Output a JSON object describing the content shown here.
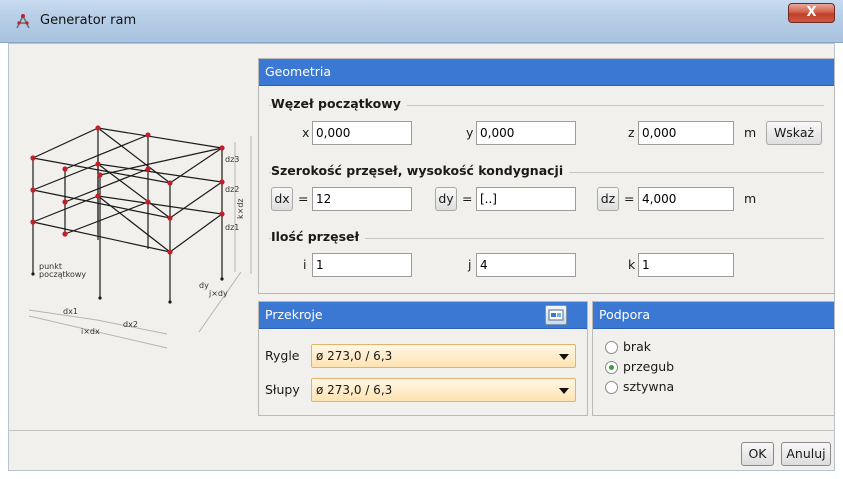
{
  "window": {
    "title": "Generator ram",
    "close_label": "X"
  },
  "diagram": {
    "labels": {
      "dz3": "dz3",
      "dz2": "dz2",
      "dz1": "dz1",
      "kdz": "k×dz",
      "dy": "dy",
      "jdy": "j×dy",
      "dx1": "dx1",
      "dx2": "dx2",
      "idx": "i×dx",
      "punkt": "punkt",
      "poczatkowy": "początkowy"
    }
  },
  "geometria": {
    "title": "Geometria",
    "wezel": {
      "title": "Węzeł początkowy",
      "x_label": "x",
      "x_value": "0,000",
      "y_label": "y",
      "y_value": "0,000",
      "z_label": "z",
      "z_value": "0,000",
      "unit": "m",
      "wskaz_label": "Wskaż"
    },
    "szerokosc": {
      "title": "Szerokość przęseł, wysokość kondygnacji",
      "dx_label": "dx",
      "dx_value": "12",
      "dy_label": "dy",
      "dy_value": "[..]",
      "dz_label": "dz",
      "dz_value": "4,000",
      "eq": "=",
      "unit": "m"
    },
    "ilosc": {
      "title": "Ilość przęseł",
      "i_label": "i",
      "i_value": "1",
      "j_label": "j",
      "j_value": "4",
      "k_label": "k",
      "k_value": "1"
    }
  },
  "przekroje": {
    "title": "Przekroje",
    "rygle_label": "Rygle",
    "rygle_value": "ø 273,0 / 6,3",
    "slupy_label": "Słupy",
    "slupy_value": "ø 273,0 / 6,3"
  },
  "podpora": {
    "title": "Podpora",
    "options": [
      "brak",
      "przegub",
      "sztywna"
    ],
    "selected": "przegub"
  },
  "buttons": {
    "ok": "OK",
    "anuluj": "Anuluj"
  },
  "colors": {
    "header_blue": "#3b78d4",
    "node_red": "#c0202a",
    "close_red": "#c0402b"
  }
}
